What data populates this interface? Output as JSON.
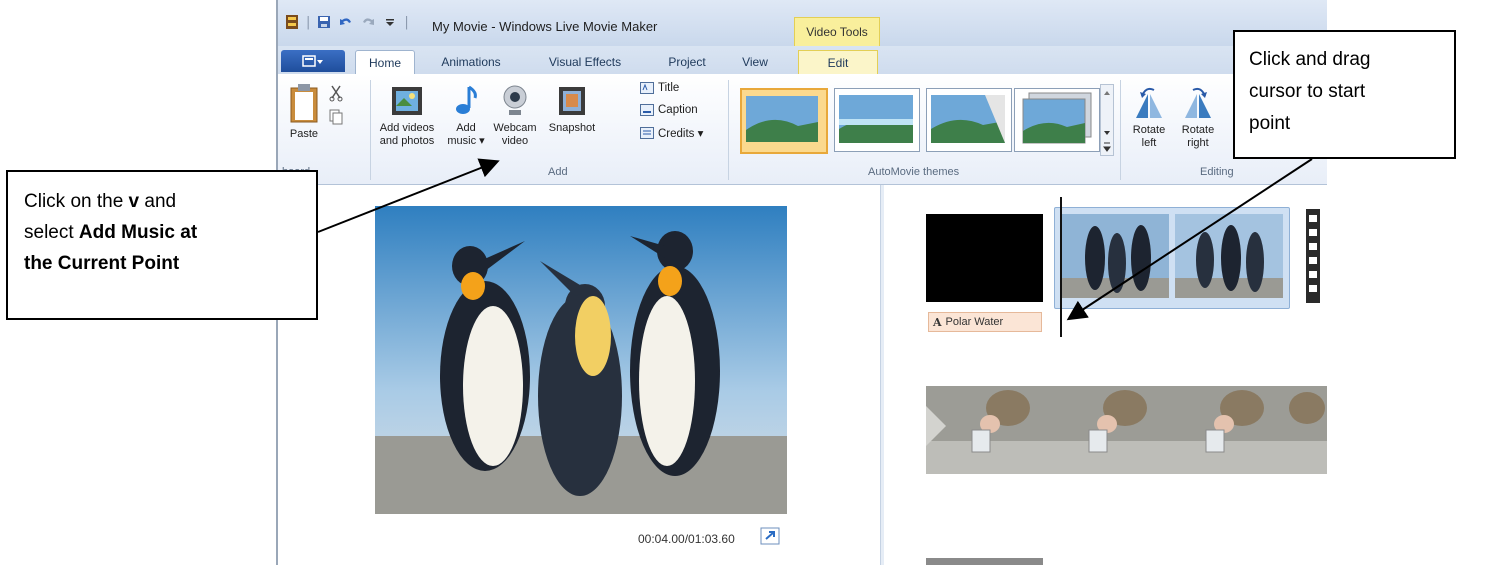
{
  "window": {
    "title": "My Movie - Windows Live Movie Maker",
    "contextual_tab": "Video Tools"
  },
  "tabs": [
    {
      "label": "Home",
      "active": true
    },
    {
      "label": "Animations",
      "active": false
    },
    {
      "label": "Visual Effects",
      "active": false
    },
    {
      "label": "Project",
      "active": false
    },
    {
      "label": "View",
      "active": false
    },
    {
      "label": "Edit",
      "active": false
    }
  ],
  "ribbon": {
    "clipboard": {
      "paste_label": "Paste",
      "group_label": "board"
    },
    "add": {
      "add_videos_label_1": "Add videos",
      "add_videos_label_2": "and photos",
      "add_music_label_1": "Add",
      "add_music_label_2": "music ▾",
      "webcam_label_1": "Webcam",
      "webcam_label_2": "video",
      "snapshot_label": "Snapshot",
      "title_label": "Title",
      "caption_label": "Caption",
      "credits_label": "Credits ▾",
      "group_label": "Add"
    },
    "themes": {
      "group_label": "AutoMovie themes"
    },
    "editing": {
      "rotate_left_1": "Rotate",
      "rotate_left_2": "left",
      "rotate_right_1": "Rotate",
      "rotate_right_2": "right",
      "group_label": "Editing"
    }
  },
  "preview": {
    "timecode": "00:04.00/01:03.60"
  },
  "storyboard": {
    "caption_text": "Polar Water",
    "caption_icon": "A"
  },
  "callouts": {
    "left": {
      "line1": "Click on the ",
      "line1_bold": "v",
      "line1_end": " and",
      "line2": "select ",
      "line2_bold": "Add Music at",
      "line3_bold": "the Current Point"
    },
    "right": {
      "line1": "Click and drag",
      "line2": "cursor to start",
      "line3": "point"
    }
  },
  "colors": {
    "ribbon_bg": "#e8eef8",
    "contextual_tab": "#f9ef9c",
    "selected_theme": "#fbd98e",
    "caption_tag": "#fbe5d6"
  }
}
